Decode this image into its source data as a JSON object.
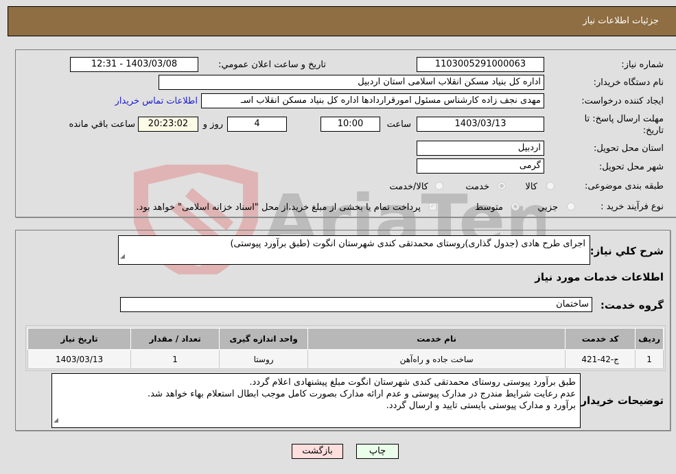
{
  "header": {
    "title": "جزئیات اطلاعات نیاز"
  },
  "need_info": {
    "need_number_label": "شماره نیاز:",
    "need_number": "1103005291000063",
    "announce_label": "تاریخ و ساعت اعلان عمومي:",
    "announce_value": "1403/03/08 - 12:31",
    "buyer_org_label": "نام دستگاه خریدار:",
    "buyer_org": "اداره کل بنیاد مسکن انقلاب اسلامی استان اردبیل",
    "creator_label": "ایجاد کننده درخواست:",
    "creator": "مهدی نجف زاده کارشناس مسئول امورقراردادها اداره کل بنیاد مسکن انقلاب اسـ",
    "contact_link": "اطلاعات تماس خریدار",
    "deadline_label_1": "مهلت ارسال پاسخ: تا",
    "deadline_label_2": "تاریخ:",
    "deadline_date": "1403/03/13",
    "time_label": "ساعت",
    "deadline_time": "10:00",
    "days_value": "4",
    "days_label": "روز و",
    "remaining_time": "20:23:02",
    "remaining_label": "ساعت باقي مانده",
    "province_label": "استان محل تحویل:",
    "province": "اردبیل",
    "city_label": "شهر محل تحویل:",
    "city": "گرمی",
    "category_label": "طبقه بندی موضوعی:",
    "category_options": [
      "کالا",
      "خدمت",
      "کالا/خدمت"
    ],
    "category_selected": "خدمت",
    "process_label": "نوع فرآیند خرید :",
    "process_options": [
      "جزيي",
      "متوسط"
    ],
    "process_selected": "متوسط",
    "treasury_note": "پرداخت تمام یا بخشی از مبلغ خرید،از محل \"اسناد خزانه اسلامی\" خواهد بود."
  },
  "details": {
    "description_label": "شرح کلي نیاز:",
    "description": "اجرای طرح هادی (جدول گذاری)روستای محمدتقی کندی شهرستان انگوت  (طبق برآورد  پیوستی)",
    "services_heading": "اطلاعات خدمات مورد نیاز",
    "service_group_label": "گروه خدمت:",
    "service_group": "ساختمان",
    "table": {
      "headers": [
        "ردیف",
        "کد خدمت",
        "نام خدمت",
        "واحد اندازه گیری",
        "تعداد / مقدار",
        "تاریخ نیاز"
      ],
      "rows": [
        [
          "1",
          "ج-42-421",
          "ساخت جاده و راه‌آهن",
          "روستا",
          "1",
          "1403/03/13"
        ]
      ]
    },
    "buyer_notes_label": "توضیحات خریدار:",
    "buyer_notes": [
      "طبق برآورد پیوستی روستای محمدتقی کندی شهرستان انگوت مبلغ پیشنهادی اعلام گردد.",
      "عدم رعایت شرایط مندرج در مدارک پیوستی و عدم ارائه مدارک بصورت کامل موجب ابطال استعلام بهاء خواهد شد.",
      "برآورد و مدارک پیوستی بایستی تایید و ارسال گردد."
    ]
  },
  "buttons": {
    "print": "چاپ",
    "back": "بازگشت"
  },
  "colors": {
    "header_bg": "#8e6e42",
    "print_bg": "#eaffea",
    "back_bg": "#ffdede",
    "link": "#1a1ad6"
  }
}
